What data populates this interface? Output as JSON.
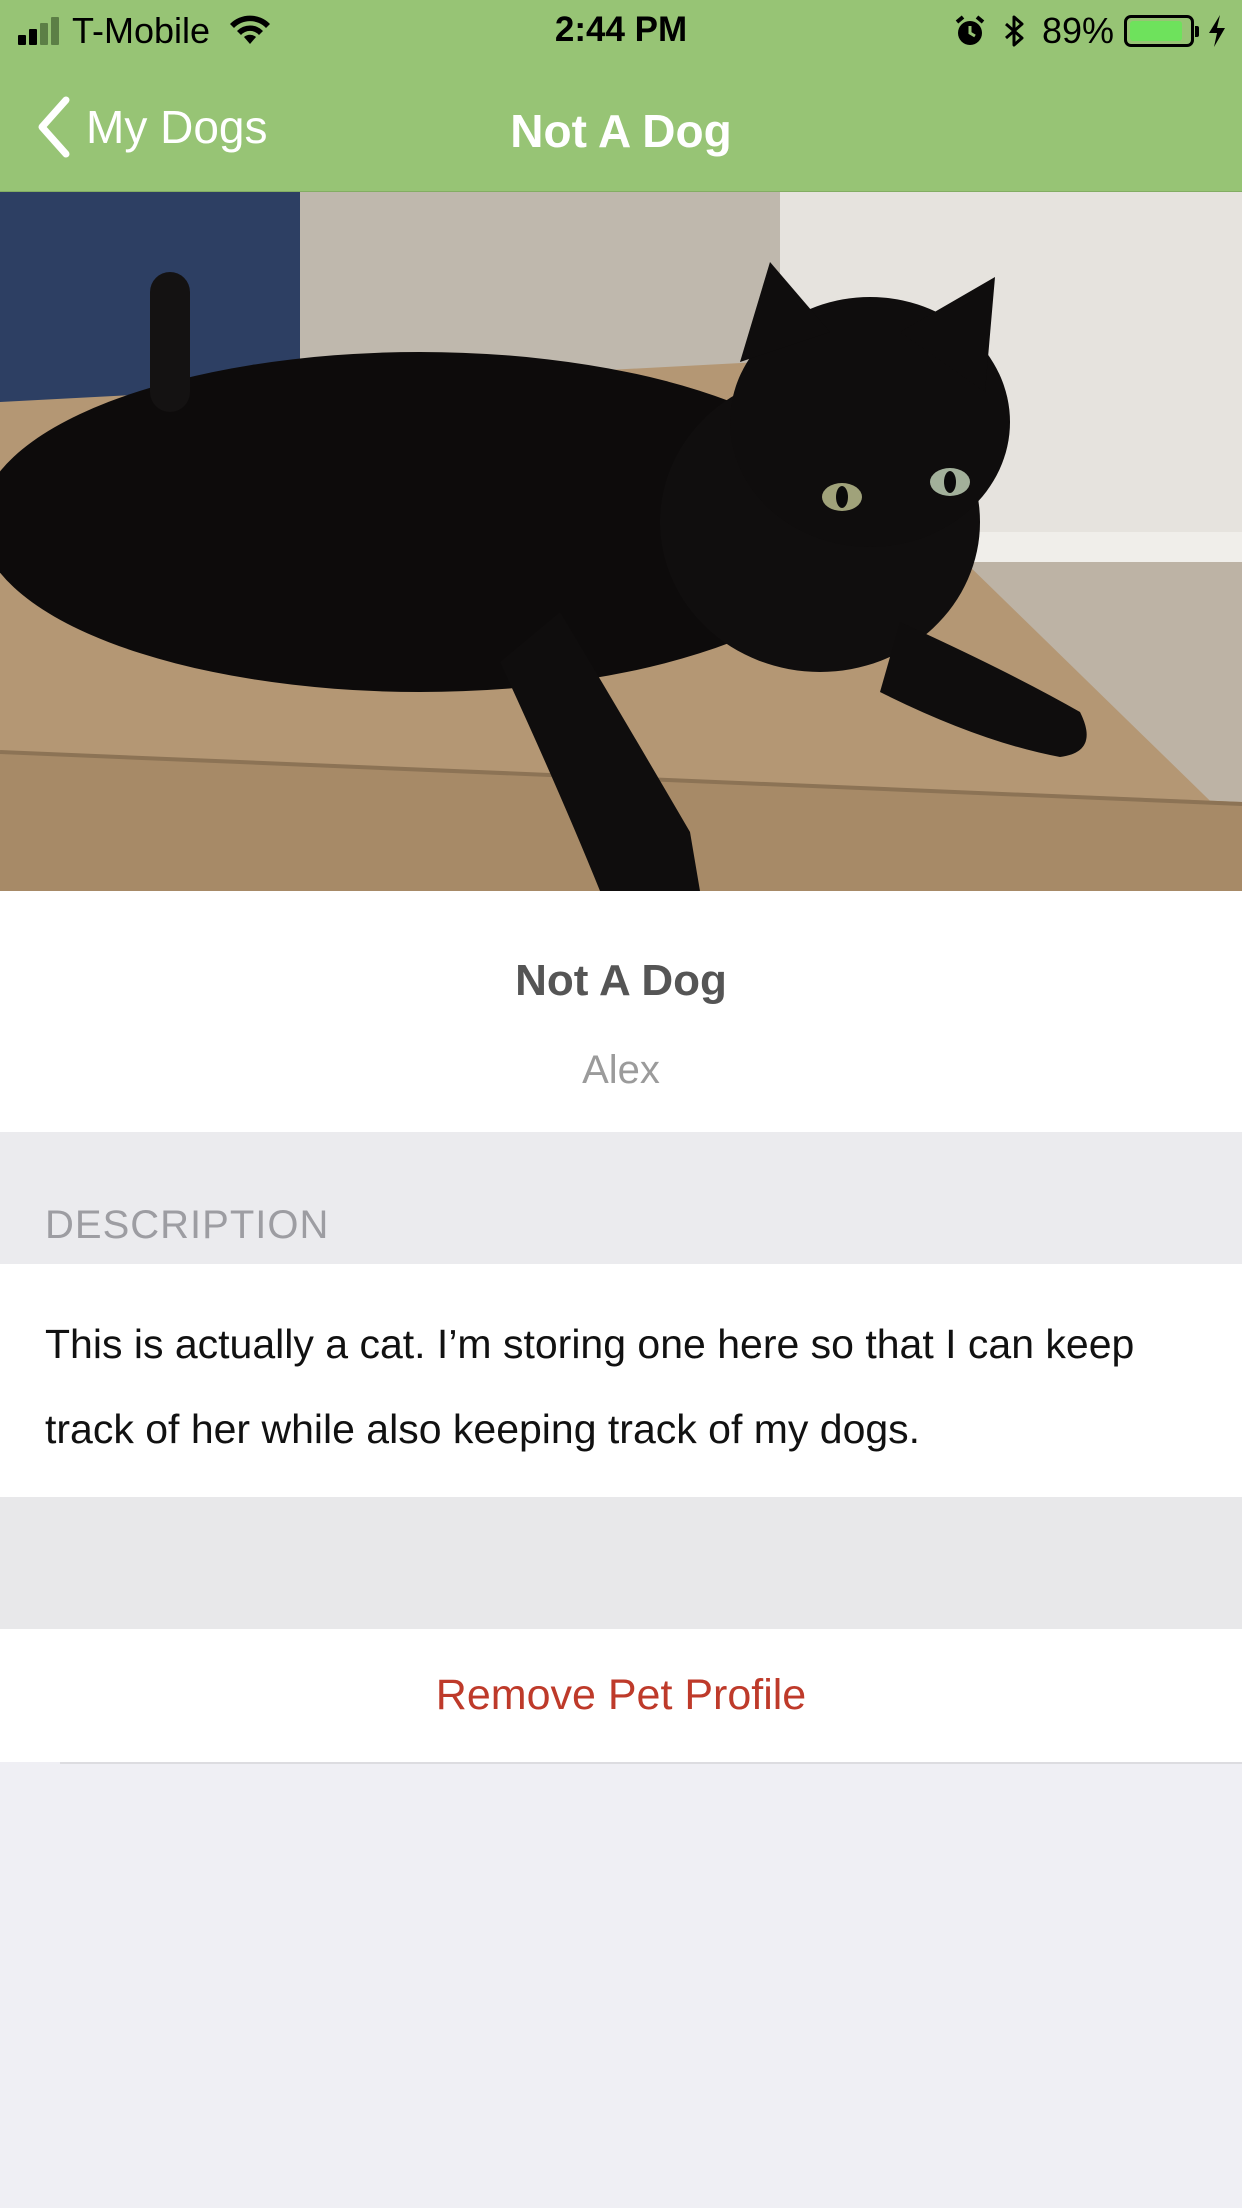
{
  "status_bar": {
    "carrier": "T-Mobile",
    "time": "2:44 PM",
    "battery_percent": "89%",
    "battery_level": 0.89
  },
  "nav": {
    "back_label": "My Dogs",
    "title": "Not A Dog"
  },
  "pet": {
    "name": "Not A Dog",
    "owner": "Alex"
  },
  "description": {
    "header": "DESCRIPTION",
    "text": "This is actually a cat. I’m storing one here so that I can keep track of her while also keeping track of my dogs."
  },
  "actions": {
    "remove_label": "Remove Pet Profile"
  },
  "colors": {
    "nav_green": "#97c475",
    "destructive_red": "#be3a2a",
    "grouped_background": "#efeff4"
  }
}
